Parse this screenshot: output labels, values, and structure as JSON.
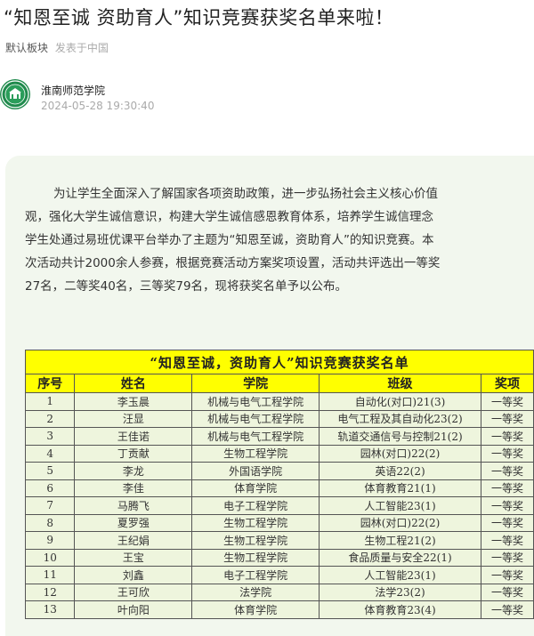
{
  "article": {
    "title": "“知恩至诚 资助育人”知识竞赛获奖名单来啦！",
    "board": "默认板块",
    "published_from": "发表于中国",
    "author": "淮南师范学院",
    "datetime": "2024-05-28 19:30:40"
  },
  "body_lines": [
    "为让学生全面深入了解国家各项资助政策，进一步弘扬社会主义核心价值",
    "观，强化大学生诚信意识，构建大学生诚信感恩教育体系，培养学生诚信理念",
    "学生处通过易班优课平台举办了主题为“知恩至诚，资助育人”的知识竞赛。本",
    "次活动共计2000余人参赛，根据竞赛活动方案奖项设置，活动共评选出一等奖",
    "27名，二等奖40名，三等奖79名，现将获奖名单予以公布。"
  ],
  "table": {
    "caption": "“知恩至诚，资助育人”知识竞赛获奖名单",
    "headers": [
      "序号",
      "姓名",
      "学院",
      "班级",
      "奖项"
    ],
    "rows": [
      [
        "1",
        "李玉晨",
        "机械与电气工程学院",
        "自动化(对口)21(3)",
        "一等奖"
      ],
      [
        "2",
        "汪显",
        "机械与电气工程学院",
        "电气工程及其自动化23(2)",
        "一等奖"
      ],
      [
        "3",
        "王佳诺",
        "机械与电气工程学院",
        "轨道交通信号与控制21(2)",
        "一等奖"
      ],
      [
        "4",
        "丁贡献",
        "生物工程学院",
        "园林(对口)22(2)",
        "一等奖"
      ],
      [
        "5",
        "李龙",
        "外国语学院",
        "英语22(2)",
        "一等奖"
      ],
      [
        "6",
        "李佳",
        "体育学院",
        "体育教育21(1)",
        "一等奖"
      ],
      [
        "7",
        "马腾飞",
        "电子工程学院",
        "人工智能23(1)",
        "一等奖"
      ],
      [
        "8",
        "夏罗强",
        "生物工程学院",
        "园林(对口)22(2)",
        "一等奖"
      ],
      [
        "9",
        "王纪娟",
        "生物工程学院",
        "生物工程21(2)",
        "一等奖"
      ],
      [
        "10",
        "王宝",
        "生物工程学院",
        "食品质量与安全22(1)",
        "一等奖"
      ],
      [
        "11",
        "刘鑫",
        "电子工程学院",
        "人工智能23(1)",
        "一等奖"
      ],
      [
        "12",
        "王可欣",
        "法学院",
        "法学23(2)",
        "一等奖"
      ],
      [
        "13",
        "叶向阳",
        "体育学院",
        "体育教育23(4)",
        "一等奖"
      ]
    ]
  },
  "colors": {
    "table_header": "#ffff00",
    "table_body": "#eef5dd",
    "card": "#f2f7ee"
  },
  "icons": {
    "logo": "school-emblem-icon"
  }
}
